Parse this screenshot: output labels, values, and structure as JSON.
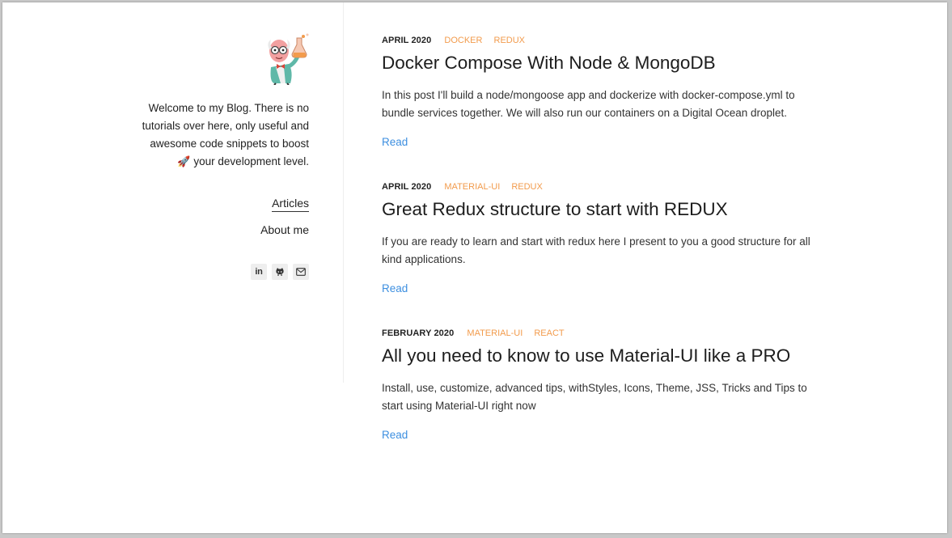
{
  "sidebar": {
    "intro_lines": [
      "Welcome to my Blog. There is no",
      "tutorials over here, only useful and",
      "awesome code snippets to boost",
      "your development level."
    ],
    "rocket_emoji": "🚀",
    "nav": {
      "articles": "Articles",
      "about": "About me"
    },
    "social": [
      {
        "icon": "linkedin-icon",
        "label": "in"
      },
      {
        "icon": "github-icon"
      },
      {
        "icon": "email-icon"
      }
    ]
  },
  "posts": [
    {
      "date": "APRIL 2020",
      "tags": [
        "DOCKER",
        "REDUX"
      ],
      "title": "Docker Compose With Node & MongoDB",
      "excerpt": "In this post I'll build a node/mongoose app and dockerize with docker-compose.yml to bundle services together. We will also run our containers on a Digital Ocean droplet.",
      "read_label": "Read"
    },
    {
      "date": "APRIL 2020",
      "tags": [
        "MATERIAL-UI",
        "REDUX"
      ],
      "title": "Great Redux structure to start with REDUX",
      "excerpt": "If you are ready to learn and start with redux here I present to you a good structure for all kind applications.",
      "read_label": "Read"
    },
    {
      "date": "FEBRUARY 2020",
      "tags": [
        "MATERIAL-UI",
        "REACT"
      ],
      "title": "All you need to know to use Material-UI like a PRO",
      "excerpt": "Install, use, customize, advanced tips, withStyles, Icons, Theme, JSS, Tricks and Tips to start using Material-UI right now",
      "read_label": "Read"
    }
  ],
  "colors": {
    "tag": "#f29b4c",
    "link": "#3d8fe0",
    "text": "#222222"
  }
}
